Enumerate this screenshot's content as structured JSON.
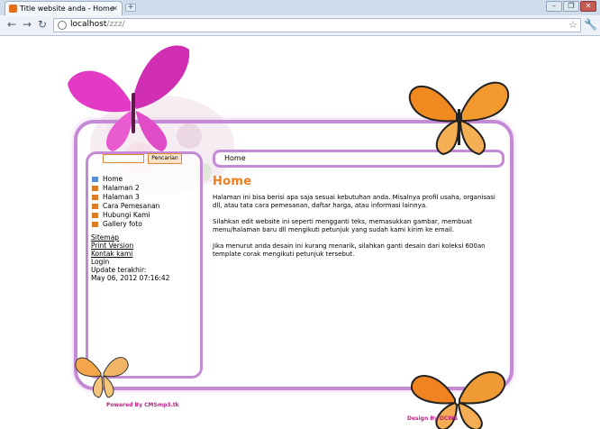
{
  "browser": {
    "tab_title": "Title website anda - Home",
    "new_tab": "+",
    "url_host": "localhost",
    "url_path": "/zzz/",
    "window_buttons": [
      "–",
      "❐",
      "✕"
    ]
  },
  "search": {
    "placeholder": "",
    "button_label": "Pencarian"
  },
  "breadcrumb": "Home",
  "menu": [
    {
      "label": "Home",
      "icon": "home-icon"
    },
    {
      "label": "Halaman 2",
      "icon": "page-icon"
    },
    {
      "label": "Halaman 3",
      "icon": "page-icon"
    },
    {
      "label": "Cara Pemesanan",
      "icon": "page-icon"
    },
    {
      "label": "Hubungi Kami",
      "icon": "page-icon"
    },
    {
      "label": "Gallery foto",
      "icon": "page-icon"
    }
  ],
  "sidebar_links": {
    "sitemap": "Sitemap",
    "print": "Print Version",
    "contact": "Kontak kami",
    "login": "Login",
    "updated_label": "Update terakhir:",
    "updated_value": "May 06, 2012 07:16:42"
  },
  "content": {
    "title": "Home",
    "paragraphs": [
      "Halaman ini bisa berisi apa saja sesuai kebutuhan anda. Misalnya profil usaha, organisasi dll, atau tata cara pemesanan, daftar harga, atau informasi lainnya.",
      "Silahkan edit website ini seperti mengganti teks, memasukkan gambar, membuat menu/halaman baru dll mengikuti petunjuk yang sudah kami kirim ke email.",
      "Jika menurut anda desain ini kurang menarik, silahkan ganti desain dari koleksi 600an template corak mengikuti petunjuk tersebut."
    ]
  },
  "footer": {
    "powered_by": "Powered By CMSmp3.tk",
    "design_by": "Design By DCWS"
  },
  "colors": {
    "accent_orange": "#f07d1a",
    "frame_purple": "#c58ad6",
    "credit_pink": "#c0208a"
  }
}
